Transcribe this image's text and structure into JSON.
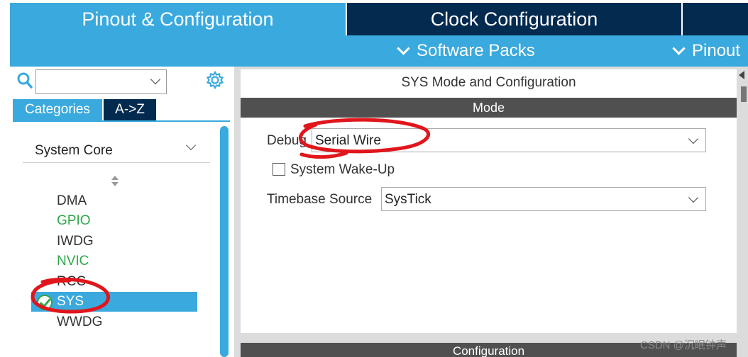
{
  "header": {
    "tabs": [
      {
        "label": "Pinout & Configuration",
        "active": true
      },
      {
        "label": "Clock Configuration",
        "active": false
      }
    ],
    "subnav": {
      "software_packs": "Software Packs",
      "pinout": "Pinout"
    }
  },
  "sidebar": {
    "search": {
      "value": "",
      "placeholder": ""
    },
    "tabs": {
      "categories": "Categories",
      "az": "A->Z"
    },
    "group": "System Core",
    "items": [
      {
        "label": "DMA",
        "state": "normal"
      },
      {
        "label": "GPIO",
        "state": "configured"
      },
      {
        "label": "IWDG",
        "state": "normal"
      },
      {
        "label": "NVIC",
        "state": "configured"
      },
      {
        "label": "RCC",
        "state": "normal"
      },
      {
        "label": "SYS",
        "state": "selected"
      },
      {
        "label": "WWDG",
        "state": "normal"
      }
    ]
  },
  "main": {
    "title": "SYS Mode and Configuration",
    "mode_header": "Mode",
    "debug": {
      "label": "Debug",
      "value": "Serial Wire"
    },
    "wakeup": {
      "label": "System Wake-Up",
      "checked": false
    },
    "timebase": {
      "label": "Timebase Source",
      "value": "SysTick"
    },
    "config_header": "Configuration"
  },
  "watermark": "CSDN @沉眠钟声",
  "colors": {
    "accent": "#3aa9dd",
    "navy": "#032a4f",
    "section_bar": "#505050",
    "configured_green": "#2ea84a",
    "annotation_red": "#e0161c"
  }
}
